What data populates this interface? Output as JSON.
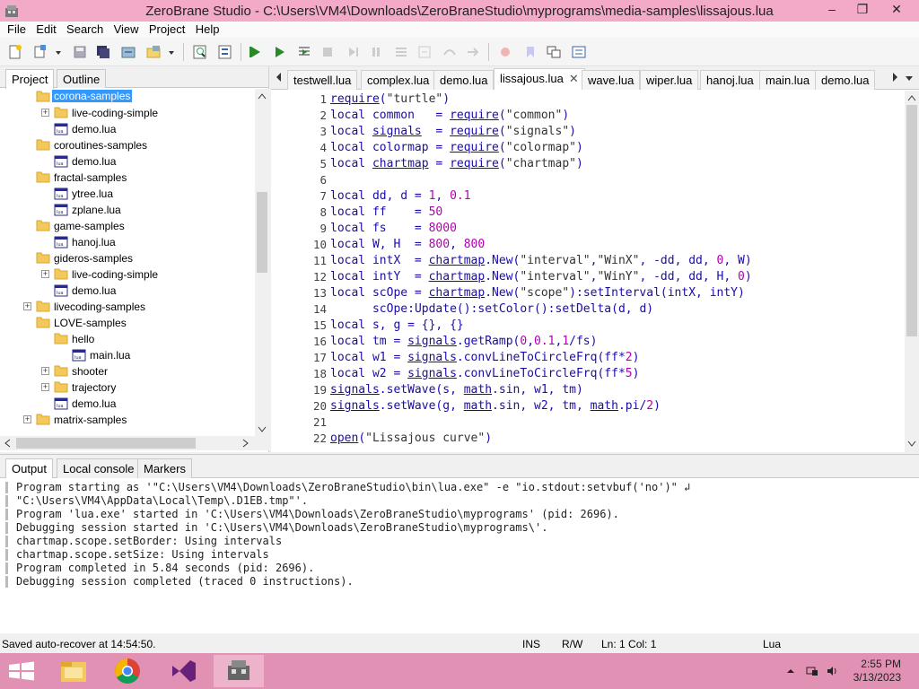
{
  "window": {
    "title": "ZeroBrane Studio - C:\\Users\\VM4\\Downloads\\ZeroBraneStudio\\myprograms\\media-samples\\lissajous.lua",
    "minimize": "‒",
    "maximize": "❐",
    "close": "✕"
  },
  "menu": [
    "File",
    "Edit",
    "Search",
    "View",
    "Project",
    "Help"
  ],
  "toolbar": {
    "icons": [
      "new-file-icon",
      "open-file-icon",
      "save-icon",
      "save-all-icon",
      "project-dir-icon",
      "recent-projects-icon",
      "find-icon",
      "replace-icon",
      "run-project-icon",
      "run-icon",
      "compile-icon",
      "stop-icon",
      "step-into-icon",
      "step-over-icon",
      "step-out-icon",
      "break-icon",
      "toggle-breakpoint-icon",
      "bookmark-icon",
      "stack-window-icon",
      "watch-window-icon"
    ]
  },
  "project_panel": {
    "tabs": [
      "Project",
      "Outline"
    ],
    "tree": [
      {
        "label": "corona-samples",
        "type": "folder",
        "depth": 0,
        "selected": true
      },
      {
        "label": "live-coding-simple",
        "type": "folder",
        "depth": 1,
        "expandable": true
      },
      {
        "label": "demo.lua",
        "type": "file",
        "depth": 1
      },
      {
        "label": "coroutines-samples",
        "type": "folder",
        "depth": 0
      },
      {
        "label": "demo.lua",
        "type": "file",
        "depth": 1
      },
      {
        "label": "fractal-samples",
        "type": "folder",
        "depth": 0
      },
      {
        "label": "ytree.lua",
        "type": "file",
        "depth": 1
      },
      {
        "label": "zplane.lua",
        "type": "file",
        "depth": 1
      },
      {
        "label": "game-samples",
        "type": "folder",
        "depth": 0
      },
      {
        "label": "hanoj.lua",
        "type": "file",
        "depth": 1
      },
      {
        "label": "gideros-samples",
        "type": "folder",
        "depth": 0
      },
      {
        "label": "live-coding-simple",
        "type": "folder",
        "depth": 1,
        "expandable": true
      },
      {
        "label": "demo.lua",
        "type": "file",
        "depth": 1
      },
      {
        "label": "livecoding-samples",
        "type": "folder",
        "depth": 0,
        "expandable": true
      },
      {
        "label": "LOVE-samples",
        "type": "folder",
        "depth": 0
      },
      {
        "label": "hello",
        "type": "folder",
        "depth": 1
      },
      {
        "label": "main.lua",
        "type": "file",
        "depth": 2
      },
      {
        "label": "shooter",
        "type": "folder",
        "depth": 1,
        "expandable": true
      },
      {
        "label": "trajectory",
        "type": "folder",
        "depth": 1,
        "expandable": true
      },
      {
        "label": "demo.lua",
        "type": "file",
        "depth": 1
      },
      {
        "label": "matrix-samples",
        "type": "folder",
        "depth": 0,
        "expandable": true
      }
    ]
  },
  "editor": {
    "tabs": [
      "testwell.lua",
      "complex.lua",
      "demo.lua",
      "lissajous.lua",
      "wave.lua",
      "wiper.lua",
      "hanoj.lua",
      "main.lua",
      "demo.lua"
    ],
    "active_tab": "lissajous.lua",
    "tab_close": "✕",
    "lines": [
      {
        "n": "1",
        "code": "require(\"turtle\")"
      },
      {
        "n": "2",
        "code": "local common   = require(\"common\")"
      },
      {
        "n": "3",
        "code": "local signals  = require(\"signals\")"
      },
      {
        "n": "4",
        "code": "local colormap = require(\"colormap\")"
      },
      {
        "n": "5",
        "code": "local chartmap = require(\"chartmap\")"
      },
      {
        "n": "6",
        "code": ""
      },
      {
        "n": "7",
        "code": "local dd, d = 1, 0.1"
      },
      {
        "n": "8",
        "code": "local ff    = 50"
      },
      {
        "n": "9",
        "code": "local fs    = 8000"
      },
      {
        "n": "10",
        "code": "local W, H  = 800, 800"
      },
      {
        "n": "11",
        "code": "local intX  = chartmap.New(\"interval\",\"WinX\", -dd, dd, 0, W)"
      },
      {
        "n": "12",
        "code": "local intY  = chartmap.New(\"interval\",\"WinY\", -dd, dd, H, 0)"
      },
      {
        "n": "13",
        "code": "local scOpe = chartmap.New(\"scope\"):setInterval(intX, intY)"
      },
      {
        "n": "14",
        "code": "      scOpe:Update():setColor():setDelta(d, d)"
      },
      {
        "n": "15",
        "code": "local s, g = {}, {}"
      },
      {
        "n": "16",
        "code": "local tm = signals.getRamp(0,0.1,1/fs)"
      },
      {
        "n": "17",
        "code": "local w1 = signals.convLineToCircleFrq(ff*2)"
      },
      {
        "n": "18",
        "code": "local w2 = signals.convLineToCircleFrq(ff*5)"
      },
      {
        "n": "19",
        "code": "signals.setWave(s, math.sin, w1, tm)"
      },
      {
        "n": "20",
        "code": "signals.setWave(g, math.sin, w2, tm, math.pi/2)"
      },
      {
        "n": "21",
        "code": ""
      },
      {
        "n": "22",
        "code": "open(\"Lissajous curve\")"
      }
    ]
  },
  "output_panel": {
    "tabs": [
      "Output",
      "Local console",
      "Markers"
    ],
    "lines": [
      "Program starting as '\"C:\\Users\\VM4\\Downloads\\ZeroBraneStudio\\bin\\lua.exe\" -e \"io.stdout:setvbuf('no')\" ↲",
      "\"C:\\Users\\VM4\\AppData\\Local\\Temp\\.D1EB.tmp\"'.",
      "Program 'lua.exe' started in 'C:\\Users\\VM4\\Downloads\\ZeroBraneStudio\\myprograms' (pid: 2696).",
      "Debugging session started in 'C:\\Users\\VM4\\Downloads\\ZeroBraneStudio\\myprograms\\'.",
      "chartmap.scope.setBorder: Using intervals",
      "chartmap.scope.setSize: Using intervals",
      "Program completed in 5.84 seconds (pid: 2696).",
      "Debugging session completed (traced 0 instructions)."
    ]
  },
  "status": {
    "message": "Saved auto-recover at 14:54:50.",
    "mode": "INS",
    "rw": "R/W",
    "position": "Ln: 1 Col: 1",
    "language": "Lua"
  },
  "taskbar": {
    "apps": [
      "windows-start-icon",
      "file-explorer-icon",
      "chrome-icon",
      "visual-studio-icon",
      "zerobrane-icon"
    ],
    "time": "2:55 PM",
    "date": "3/13/2023"
  }
}
